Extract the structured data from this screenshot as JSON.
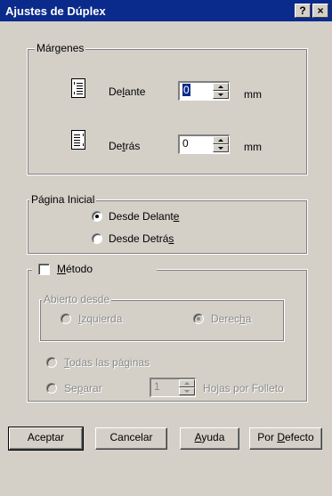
{
  "window": {
    "title": "Ajustes de Dúplex",
    "help_label": "?",
    "close_label": "×"
  },
  "margins": {
    "group_label": "Márgenes",
    "front": {
      "label_pre": "De",
      "label_ak": "l",
      "label_post": "ante",
      "value": "0",
      "unit": "mm"
    },
    "back": {
      "label_pre": "De",
      "label_ak": "t",
      "label_post": "rás",
      "value": "0",
      "unit": "mm"
    }
  },
  "start_page": {
    "group_label": "Página Inicial",
    "front": {
      "label_pre": "Desde Delant",
      "label_ak": "e",
      "label_post": ""
    },
    "back": {
      "label_pre": "Desde Detrá",
      "label_ak": "s",
      "label_post": ""
    },
    "selected": "front"
  },
  "method": {
    "checkbox_pre": "",
    "checkbox_ak": "M",
    "checkbox_post": "étodo",
    "checked": false,
    "open_from": {
      "group_label": "Abierto desde",
      "left": {
        "label_pre": "",
        "label_ak": "I",
        "label_post": "zquierda"
      },
      "right": {
        "label_pre": "Derec",
        "label_ak": "h",
        "label_post": "a"
      },
      "selected": "right"
    },
    "all_pages": {
      "label_pre": "",
      "label_ak": "T",
      "label_post": "odas las páginas"
    },
    "separate": {
      "label_pre": "Se",
      "label_ak": "p",
      "label_post": "arar"
    },
    "sheets_value": "1",
    "sheets_label": "Hojas por Folleto"
  },
  "buttons": {
    "ok": "Aceptar",
    "cancel": "Cancelar",
    "help": {
      "label_pre": "",
      "label_ak": "A",
      "label_post": "yuda"
    },
    "defaults": {
      "label_pre": "Por ",
      "label_ak": "D",
      "label_post": "efecto"
    }
  }
}
